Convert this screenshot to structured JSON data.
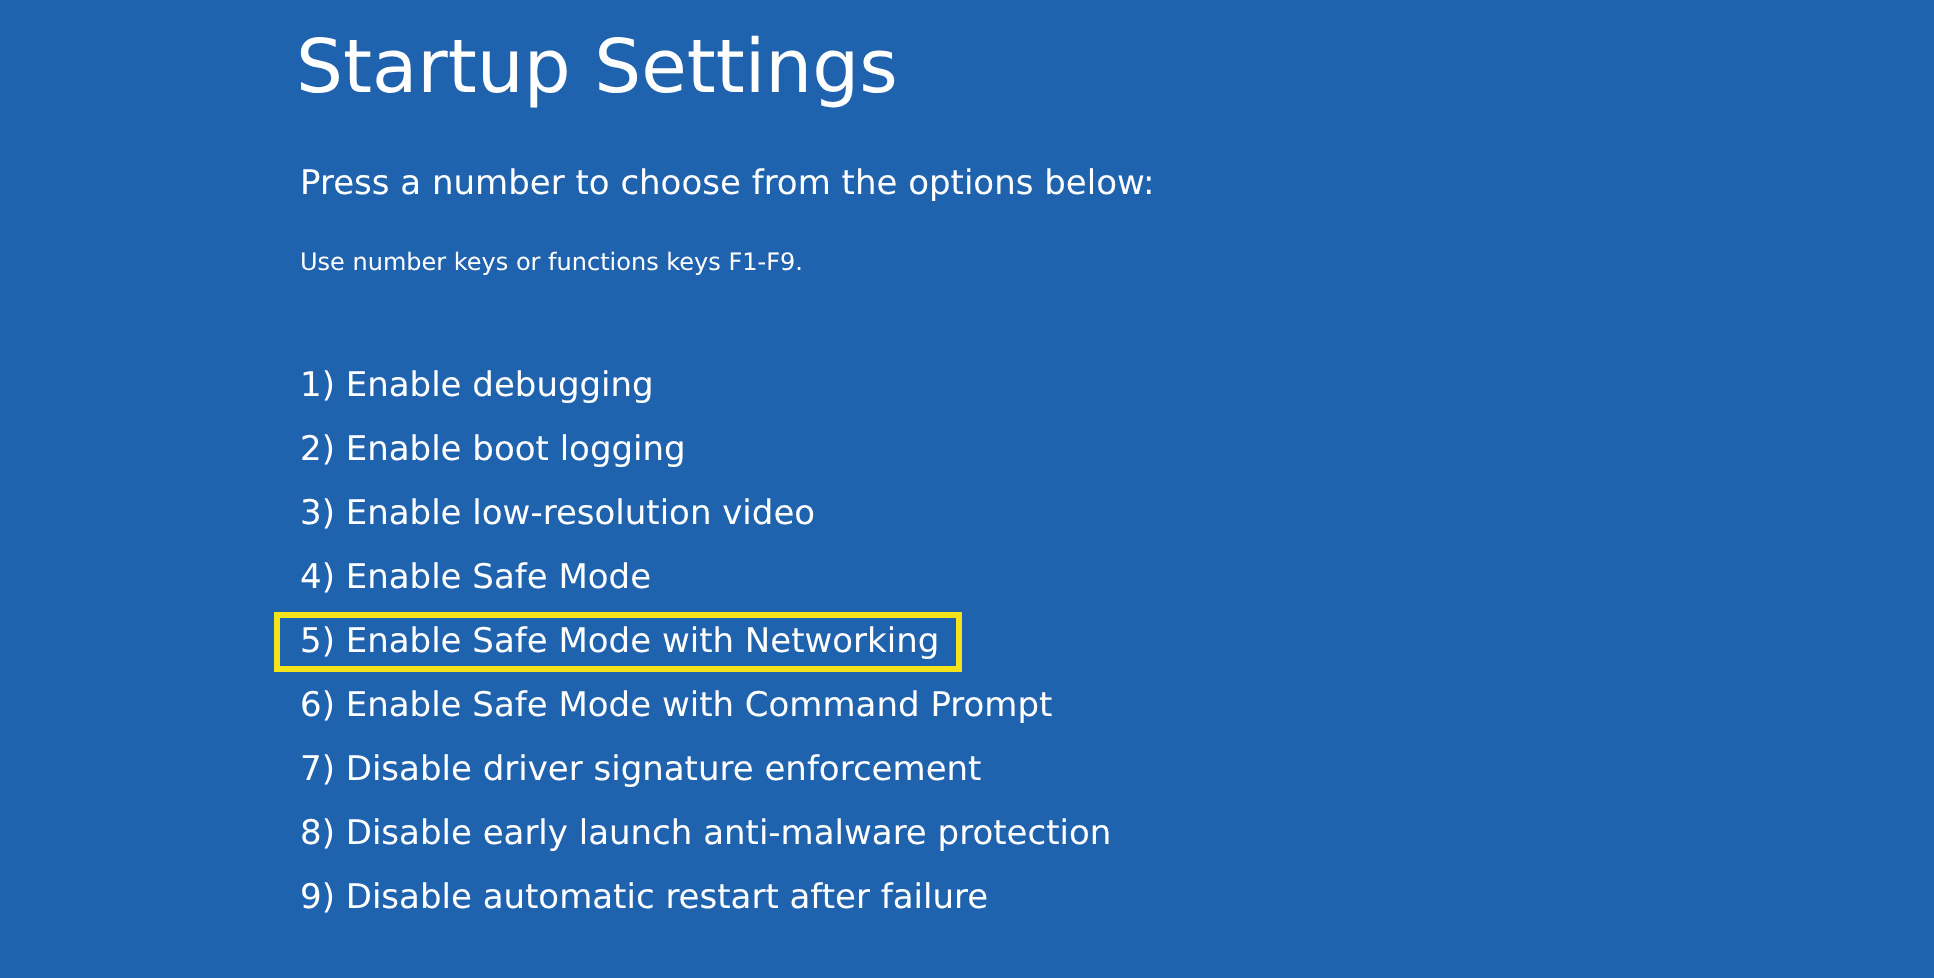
{
  "title": "Startup Settings",
  "prompt": "Press a number to choose from the options below:",
  "hint": "Use number keys or functions keys F1-F9.",
  "options": [
    {
      "label": "1) Enable debugging",
      "highlighted": false
    },
    {
      "label": "2) Enable boot logging",
      "highlighted": false
    },
    {
      "label": "3) Enable low-resolution video",
      "highlighted": false
    },
    {
      "label": "4) Enable Safe Mode",
      "highlighted": false
    },
    {
      "label": "5) Enable Safe Mode with Networking",
      "highlighted": true
    },
    {
      "label": "6) Enable Safe Mode with Command Prompt",
      "highlighted": false
    },
    {
      "label": "7) Disable driver signature enforcement",
      "highlighted": false
    },
    {
      "label": "8) Disable early launch anti-malware protection",
      "highlighted": false
    },
    {
      "label": "9) Disable automatic restart after failure",
      "highlighted": false
    }
  ]
}
